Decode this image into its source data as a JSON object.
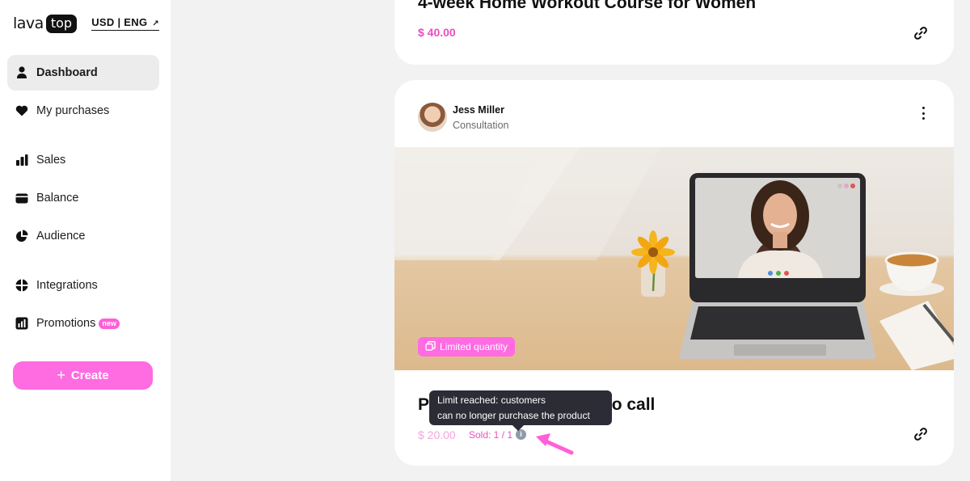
{
  "brand": {
    "name_left": "lava",
    "name_right": "top"
  },
  "locale": {
    "label": "USD | ENG",
    "arrow": "↗"
  },
  "nav": [
    {
      "label": "Dashboard",
      "icon": "user-icon",
      "active": true
    },
    {
      "label": "My purchases",
      "icon": "heart-icon"
    },
    {
      "label": "Sales",
      "icon": "bar-chart-icon"
    },
    {
      "label": "Balance",
      "icon": "wallet-icon"
    },
    {
      "label": "Audience",
      "icon": "pie-chart-icon"
    },
    {
      "label": "Integrations",
      "icon": "grid-circle-icon"
    },
    {
      "label": "Promotions",
      "icon": "stats-icon",
      "badge": "new"
    }
  ],
  "create": {
    "label": "Create",
    "plus": "+"
  },
  "top_card": {
    "title": "4-week Home Workout Course for Women",
    "price": "$ 40.00"
  },
  "product": {
    "author": "Jess Miller",
    "category": "Consultation",
    "limited_label": "Limited quantity",
    "title_start": "P",
    "title_end": "eo call",
    "price": "$ 20.00",
    "sold": "Sold: 1 / 1",
    "info": "i"
  },
  "tooltip": {
    "line1": "Limit reached: customers",
    "line2": "can no longer purchase the product"
  },
  "colors": {
    "accent": "#ff6be0",
    "price": "#e94fbf",
    "tooltip_bg": "#2b2c35"
  }
}
